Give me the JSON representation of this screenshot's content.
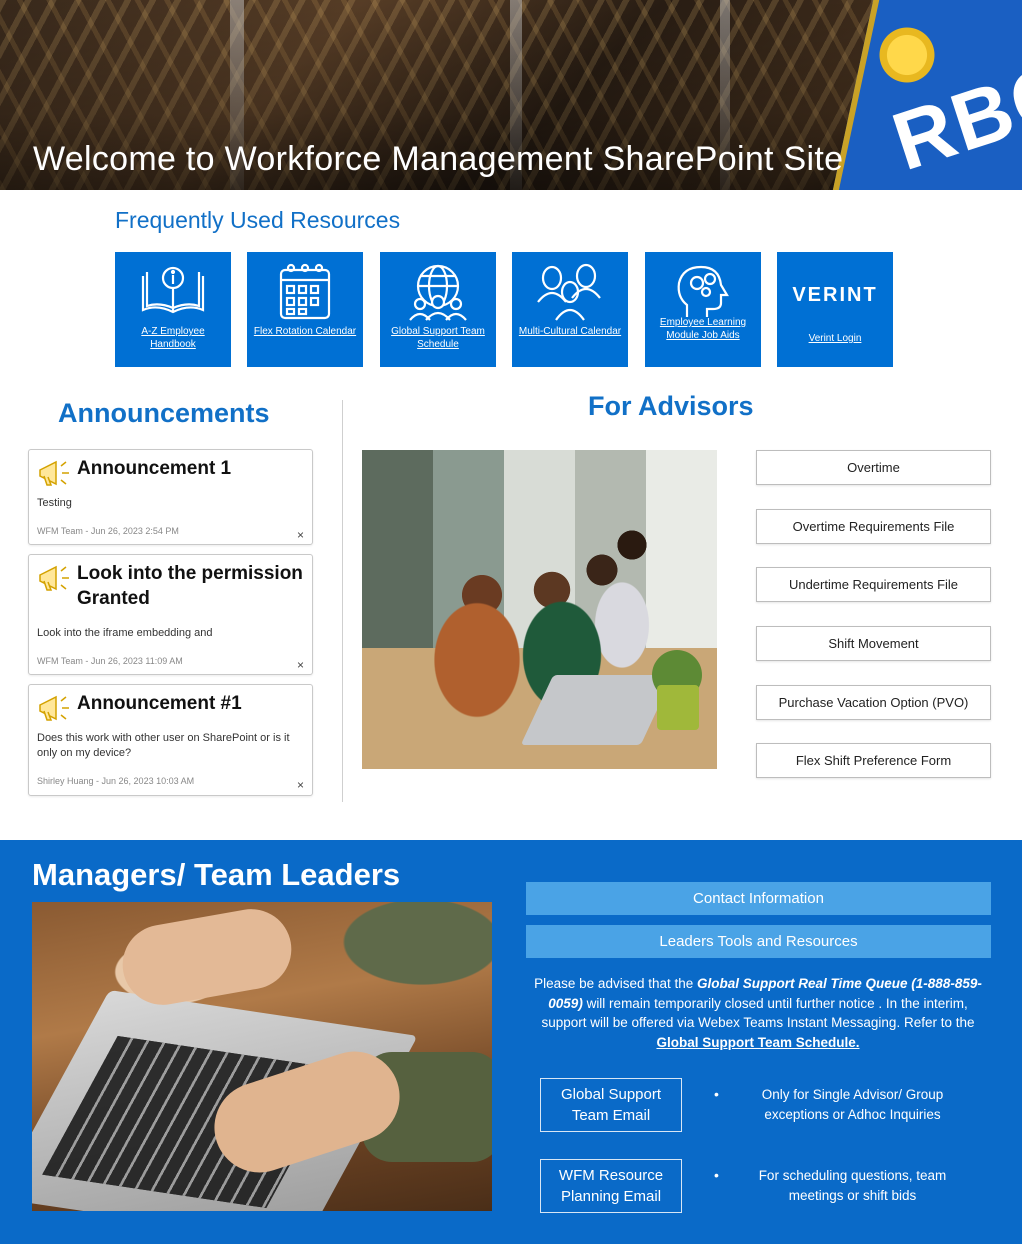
{
  "hero": {
    "title": "Welcome to Workforce Management SharePoint Site"
  },
  "resources": {
    "title": "Frequently Used Resources",
    "tiles": [
      {
        "label": "A-Z Employee Handbook",
        "icon": "book-info-icon"
      },
      {
        "label": "Flex Rotation Calendar",
        "icon": "calendar-icon"
      },
      {
        "label": "Global Support Team Schedule",
        "icon": "globe-team-icon"
      },
      {
        "label": "Multi-Cultural Calendar",
        "icon": "people-group-icon"
      },
      {
        "label": "Employee Learning Module Job Aids",
        "icon": "head-gears-icon"
      },
      {
        "label": "Verint Login",
        "logo": "VERINT"
      }
    ]
  },
  "announcements": {
    "title": "Announcements",
    "items": [
      {
        "title": "Announcement 1",
        "body": "Testing",
        "meta": "WFM Team - Jun 26, 2023 2:54 PM",
        "close": "×"
      },
      {
        "title": "Look into the permission Granted",
        "body": "Look into the iframe embedding and",
        "meta": "WFM Team - Jun 26, 2023 11:09 AM",
        "close": "×"
      },
      {
        "title": "Announcement #1",
        "body": "Does this work with other user on SharePoint or is it only on my device?",
        "meta": "Shirley Huang - Jun 26, 2023 10:03 AM",
        "close": "×"
      }
    ]
  },
  "advisors": {
    "title": "For Advisors",
    "buttons": [
      "Overtime",
      "Overtime Requirements File",
      "Undertime Requirements File",
      "Shift Movement",
      "Purchase Vacation Option (PVO)",
      "Flex Shift Preference Form"
    ]
  },
  "managers": {
    "title": "Managers/ Team Leaders",
    "bars": [
      "Contact Information",
      "Leaders Tools and Resources"
    ],
    "notice": {
      "p1": "Please be advised that the ",
      "queue": "Global Support Real Time Queue (1-888-859-0059)",
      "p2": " will remain temporarily closed until further notice . In the interim, support will be offered via Webex Teams Instant Messaging. Refer to the ",
      "link": "Global Support Team Schedule."
    },
    "contacts": [
      {
        "button": "Global Support Team Email",
        "bullet": "•",
        "desc": "Only for Single Advisor/ Group exceptions or Adhoc Inquiries"
      },
      {
        "button": "WFM Resource Planning Email",
        "bullet": "•",
        "desc": "For scheduling questions, team meetings or shift bids"
      }
    ]
  },
  "colors": {
    "brand_blue": "#0070d4",
    "section_blue": "#0a6ac8",
    "bar_blue": "#4aa3e6",
    "heading_blue": "#1170c7"
  }
}
